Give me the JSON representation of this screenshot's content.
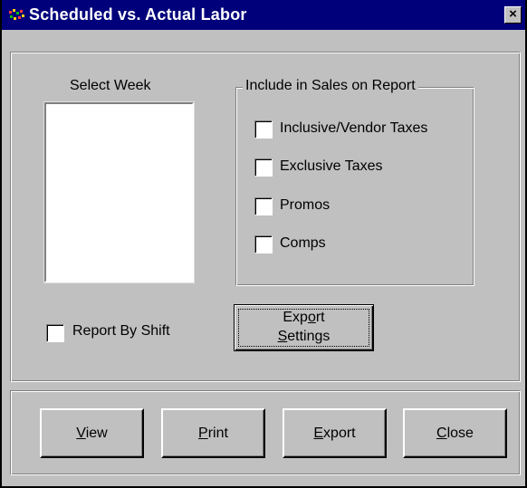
{
  "window": {
    "title": "Scheduled vs. Actual Labor",
    "close_glyph": "×",
    "icon": "app-icon"
  },
  "select_week": {
    "label": "Select Week",
    "items": []
  },
  "include_group": {
    "legend": "Include in Sales on Report",
    "options": [
      {
        "label": "Inclusive/Vendor Taxes",
        "checked": false
      },
      {
        "label": "Exclusive Taxes",
        "checked": false
      },
      {
        "label": "Promos",
        "checked": false
      },
      {
        "label": "Comps",
        "checked": false
      }
    ]
  },
  "report_by_shift": {
    "label": "Report By Shift",
    "checked": false
  },
  "export_settings": {
    "line1_prefix": "Exp",
    "line1_accel": "o",
    "line1_suffix": "rt",
    "line2_accel": "S",
    "line2_suffix": "ettings"
  },
  "buttons": {
    "view": {
      "accel": "V",
      "rest": "iew"
    },
    "print": {
      "accel": "P",
      "rest": "rint"
    },
    "export": {
      "accel": "E",
      "rest": "xport"
    },
    "close": {
      "accel": "C",
      "rest": "lose"
    }
  },
  "colors": {
    "titlebar": "#00007b",
    "face": "#c0c0c0",
    "highlight": "#ffffff",
    "shadow": "#808080"
  }
}
